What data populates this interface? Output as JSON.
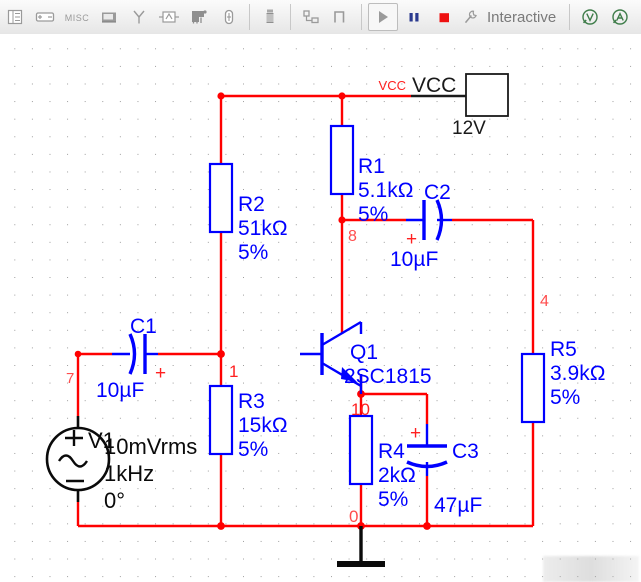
{
  "toolbar": {
    "groups": [
      {
        "buttons": [
          {
            "name": "sources-toolbar-icon",
            "label": "Sources"
          },
          {
            "name": "basic-battery-icon",
            "label": "Basic"
          },
          {
            "name": "misc-icon",
            "label": "MISC"
          },
          {
            "name": "diode-icon",
            "label": "Diodes"
          },
          {
            "name": "antenna-icon",
            "label": "Transistors"
          },
          {
            "name": "analog-icon",
            "label": "Analog"
          },
          {
            "name": "tti-icon",
            "label": "TTL"
          },
          {
            "name": "cmos-icon",
            "label": "CMOS"
          }
        ]
      },
      {
        "buttons": [
          {
            "name": "misc-digital-icon",
            "label": "Misc Digital"
          }
        ]
      },
      {
        "buttons": [
          {
            "name": "mixed-icon",
            "label": "Mixed"
          },
          {
            "name": "indicator-step-icon",
            "label": "Indicators"
          }
        ]
      },
      {
        "buttons": [
          {
            "name": "run-button",
            "label": "Run"
          }
        ]
      },
      {
        "buttons": [
          {
            "name": "pause-button",
            "label": "Pause"
          },
          {
            "name": "stop-button",
            "label": "Stop"
          },
          {
            "name": "simulation-mode-icon",
            "label": "Simulation settings"
          }
        ]
      },
      {
        "buttons": [
          {
            "name": "voltmeter-probe-icon",
            "label": "Voltage probe"
          },
          {
            "name": "ammeter-probe-icon",
            "label": "Current probe"
          }
        ]
      }
    ],
    "interactive_label": "Interactive",
    "colors": {
      "pause": "#2b3a8f",
      "stop": "#ee1111",
      "run": "#8c8c8c",
      "probe": "#3f7d4a"
    }
  },
  "schematic": {
    "colors": {
      "wire": "#ff0000",
      "component": "#0000ff",
      "label_component": "#0000ff",
      "label_node": "#ff2020",
      "label_black": "#000000",
      "ground": "#000000"
    },
    "power_supply": {
      "net_label": "VCC",
      "name": "VCC",
      "value": "12V"
    },
    "source": {
      "ref": "V1",
      "amplitude": "10mVrms",
      "frequency": "1kHz",
      "phase": "0°",
      "plus": "+",
      "minus": "−"
    },
    "transistor": {
      "ref": "Q1",
      "part": "2SC1815"
    },
    "resistors": [
      {
        "ref": "R1",
        "value": "5.1kΩ",
        "tol": "5%"
      },
      {
        "ref": "R2",
        "value": "51kΩ",
        "tol": "5%"
      },
      {
        "ref": "R3",
        "value": "15kΩ",
        "tol": "5%"
      },
      {
        "ref": "R4",
        "value": "2kΩ",
        "tol": "5%"
      },
      {
        "ref": "R5",
        "value": "3.9kΩ",
        "tol": "5%"
      }
    ],
    "capacitors": [
      {
        "ref": "C1",
        "value": "10µF",
        "polarity": "+"
      },
      {
        "ref": "C2",
        "value": "10µF",
        "polarity": "+"
      },
      {
        "ref": "C3",
        "value": "47µF",
        "polarity": "+"
      }
    ],
    "nodes": [
      {
        "id": "7"
      },
      {
        "id": "1"
      },
      {
        "id": "8"
      },
      {
        "id": "4"
      },
      {
        "id": "10"
      },
      {
        "id": "0"
      }
    ]
  }
}
